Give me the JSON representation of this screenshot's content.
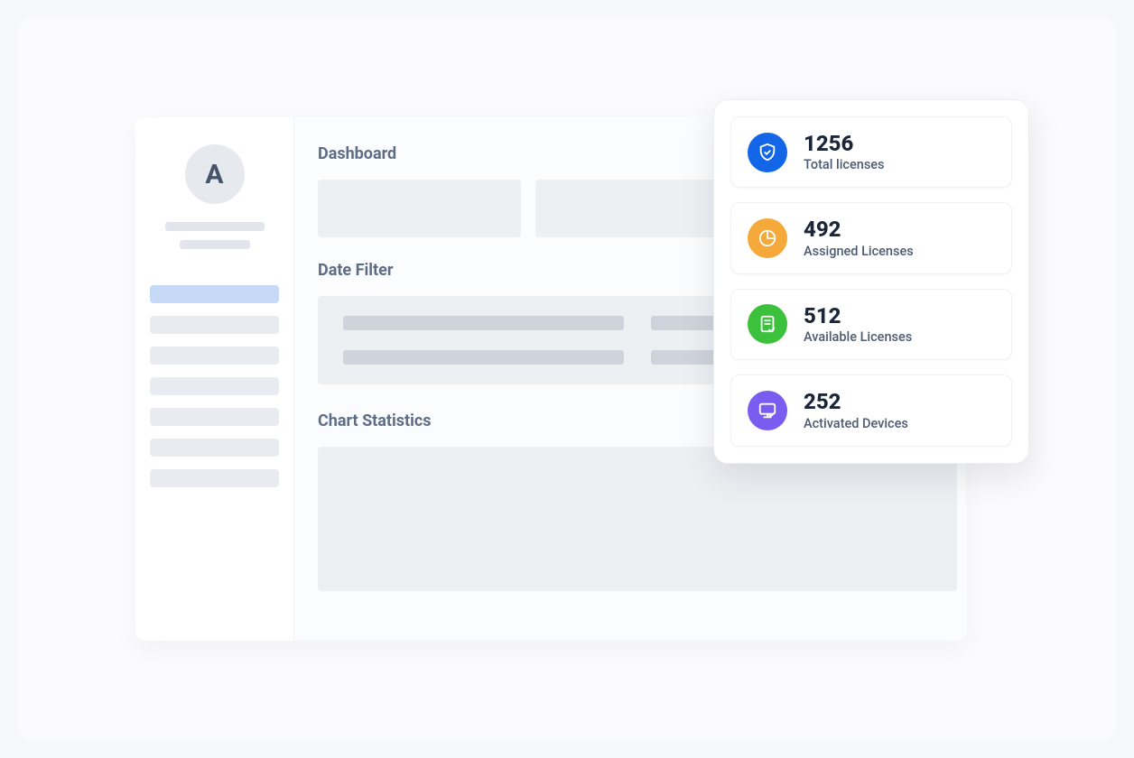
{
  "sidebar": {
    "avatar_initial": "A"
  },
  "main": {
    "dashboard_heading": "Dashboard",
    "date_filter_heading": "Date Filter",
    "chart_heading": "Chart Statistics"
  },
  "stats": {
    "items": [
      {
        "value": "1256",
        "label": "Total licenses",
        "icon": "shield-check",
        "color": "blue"
      },
      {
        "value": "492",
        "label": "Assigned Licenses",
        "icon": "pie-chart",
        "color": "orange"
      },
      {
        "value": "512",
        "label": "Available Licenses",
        "icon": "document-check",
        "color": "green"
      },
      {
        "value": "252",
        "label": "Activated Devices",
        "icon": "monitor-check",
        "color": "purple"
      }
    ]
  }
}
